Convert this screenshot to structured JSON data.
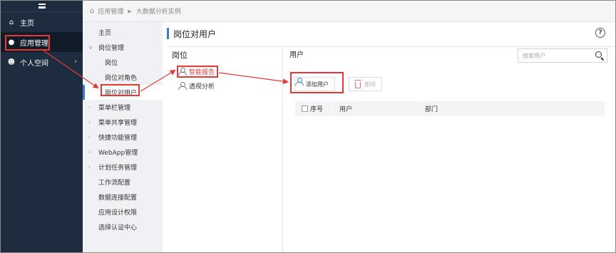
{
  "nav": {
    "items": [
      {
        "label": "主页",
        "icon": "home-icon"
      },
      {
        "label": "应用管理",
        "icon": "bulb-icon"
      },
      {
        "label": "个人空间",
        "icon": "user-icon"
      }
    ]
  },
  "breadcrumb": {
    "items": [
      "应用管理",
      "大数据分析实例"
    ]
  },
  "submenu": {
    "items": [
      {
        "label": "主页"
      },
      {
        "label": "岗位管理"
      },
      {
        "label": "岗位"
      },
      {
        "label": "岗位对角色"
      },
      {
        "label": "岗位对用户"
      },
      {
        "label": "菜单栏管理"
      },
      {
        "label": "菜单共享管理"
      },
      {
        "label": "快捷功能管理"
      },
      {
        "label": "WebApp管理"
      },
      {
        "label": "计划任务管理"
      },
      {
        "label": "工作流配置"
      },
      {
        "label": "数据连接配置"
      },
      {
        "label": "应用设计权限"
      },
      {
        "label": "选择认证中心"
      }
    ]
  },
  "page": {
    "title": "岗位对用户",
    "help": "?"
  },
  "posts": {
    "header": "岗位",
    "items": [
      {
        "label": "智能报告"
      },
      {
        "label": "透视分析"
      }
    ]
  },
  "users": {
    "header": "用户",
    "search_placeholder": "搜索用户",
    "add_label": "添加用户",
    "delete_label": "删除",
    "columns": [
      "序号",
      "用户",
      "部门"
    ]
  },
  "colors": {
    "nav_bg": "#1d2c3f",
    "accent": "#3e7bd6",
    "highlight": "#e53935"
  }
}
